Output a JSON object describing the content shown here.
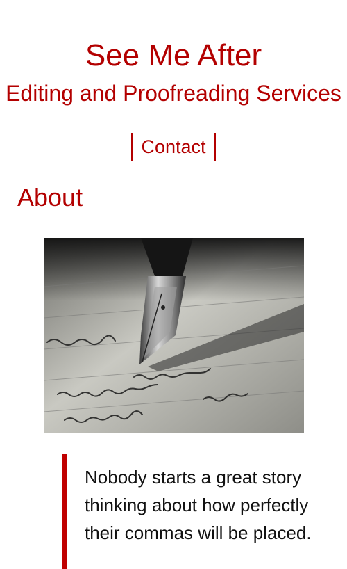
{
  "header": {
    "title": "See Me After",
    "tagline": "Editing and Proofreading Services"
  },
  "nav": {
    "items": [
      {
        "label": "Contact"
      }
    ]
  },
  "main": {
    "heading": "About",
    "image": {
      "icon": "fountain-pen-writing-photo"
    },
    "quote": "Nobody starts a great story thinking about how perfectly their commas will be placed."
  },
  "colors": {
    "accent": "#b30000",
    "quote_bar": "#c00000",
    "text": "#111111",
    "background": "#ffffff"
  }
}
